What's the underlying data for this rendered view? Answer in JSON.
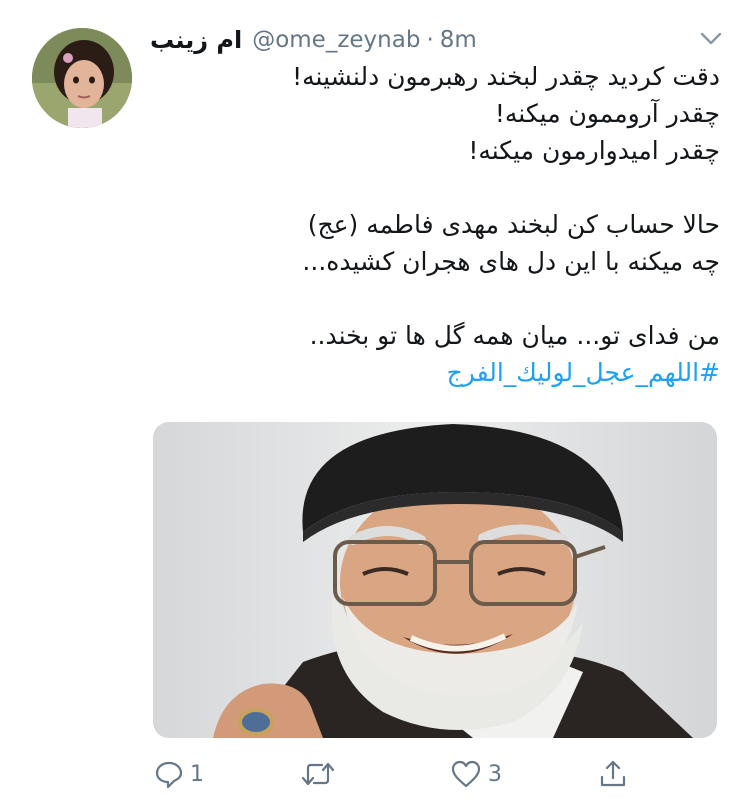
{
  "tweet": {
    "display_name": "ام زینب",
    "handle": "@ome_zeynab",
    "separator": "·",
    "time": "8m",
    "lines": [
      "دقت کردید چقدر لبخند رهبرمون دلنشینه!",
      "چقدر آروممون میکنه!",
      "چقدر امیدوارمون میکنه!",
      "",
      "حالا حساب کن لبخند مهدی فاطمه (عج)",
      "چه میکنه با این دل های هجران کشیده...",
      "",
      "من فدای تو... میان همه گل ها تو بخند.."
    ],
    "hashtag": "#اللهم_عجل_لوليك_الفرج"
  },
  "actions": {
    "reply_count": "1",
    "retweet_count": "",
    "like_count": "3"
  },
  "icons": {
    "menu": "chevron-down-icon",
    "reply": "reply-icon",
    "retweet": "retweet-icon",
    "like": "heart-icon",
    "share": "share-icon"
  },
  "colors": {
    "text": "#14171a",
    "secondary": "#657786",
    "link": "#1da1f2",
    "background": "#ffffff"
  }
}
